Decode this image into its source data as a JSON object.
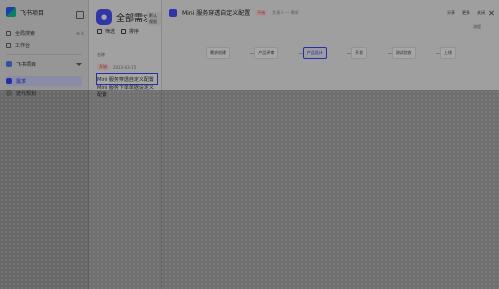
{
  "sidebar": {
    "brand_title": "飞书项目",
    "nav_items": [
      {
        "label": "全局搜索",
        "shortcut": "⌘ K",
        "icon": "search-icon"
      },
      {
        "label": "工作台",
        "shortcut": "",
        "icon": "desktop-icon"
      }
    ],
    "space": {
      "label": "飞书项目"
    },
    "sub_items": [
      {
        "label": "需求",
        "active": true
      },
      {
        "label": "迭代规划",
        "active": false
      }
    ]
  },
  "middle": {
    "title": "全部需求",
    "tag": "默认视图",
    "tools": [
      "筛选",
      "排序"
    ],
    "list_header": "名称",
    "rows": [
      {
        "status": "开始",
        "title": "Mini 服务穿透自定义配置",
        "meta": "2023-03-15",
        "selected": true
      },
      {
        "status": "",
        "title": "Mini 服务下单单据设定义配置",
        "meta": "",
        "selected": false
      }
    ]
  },
  "detail": {
    "title": "Mini 服务穿透自定义配置",
    "status": "开始",
    "subtitle": "负责人 一 需求",
    "actions": [
      "分享",
      "更多",
      "关闭"
    ],
    "right_label": "流程",
    "workflow_steps": [
      {
        "label": "需求创建",
        "current": false
      },
      {
        "label": "产品评审",
        "current": false
      },
      {
        "label": "产品设计",
        "current": true
      },
      {
        "label": "开发",
        "current": false
      },
      {
        "label": "测试验收",
        "current": false
      },
      {
        "label": "上线",
        "current": false
      }
    ]
  }
}
